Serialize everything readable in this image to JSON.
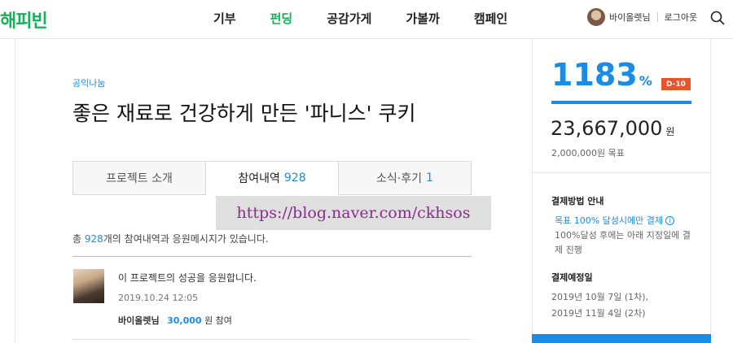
{
  "header": {
    "logo": "해피빈",
    "nav": [
      "기부",
      "펀딩",
      "공감가게",
      "가볼까",
      "캠페인"
    ],
    "active_nav": "펀딩",
    "user_name": "바이올렛님",
    "logout": "로그아웃",
    "search_icon": "search-icon"
  },
  "project": {
    "category": "공익나눔",
    "title": "좋은 재료로 건강하게 만든 '파니스' 쿠키"
  },
  "tabs": [
    {
      "label": "프로젝트 소개",
      "count": ""
    },
    {
      "label": "참여내역",
      "count": "928"
    },
    {
      "label": "소식·후기",
      "count": "1"
    }
  ],
  "watermark": "https://blog.naver.com/ckhsos",
  "summary": {
    "prefix": "총 ",
    "count": "928",
    "suffix": "개의 참여내역과 응원메시지가 있습니다."
  },
  "entry": {
    "message": "이 프로젝트의 성공을 응원합니다.",
    "date": "2019.10.24 12:05",
    "name": "바이올렛님",
    "amount": "30,000",
    "amount_suffix": "원 참여"
  },
  "funding": {
    "percent": "1183",
    "percent_unit": "%",
    "dday": "D-10",
    "progress": 1.0,
    "amount": "23,667,000",
    "amount_unit": "원",
    "goal": "2,000,000원 목표",
    "pay_title": "결제방법 안내",
    "pay_link": "목표 100% 달성시에만 결제",
    "pay_desc": "100%달성 후에는 아래 지정일에 결제 진행",
    "schedule_title": "결제예정일",
    "schedule": [
      "2019년 10월 7일 (1차),",
      "2019년 11월 4일 (2차)"
    ]
  },
  "colors": {
    "brand_green": "#17b05a",
    "accent_blue": "#1b8ce3",
    "dday_red": "#e8552c"
  }
}
